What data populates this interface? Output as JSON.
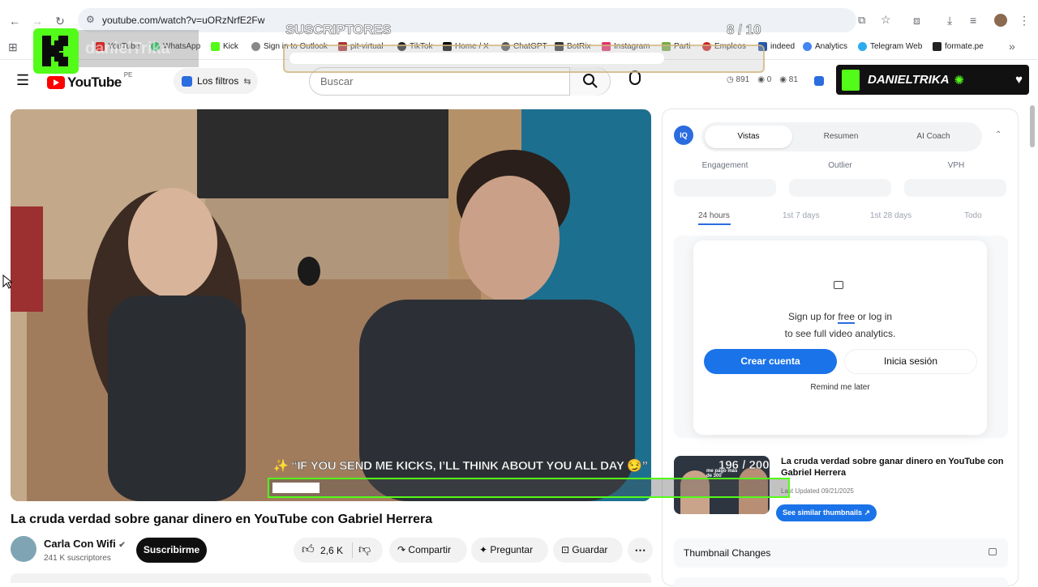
{
  "browser": {
    "url": "youtube.com/watch?v=uORzNrfE2Fw",
    "bookmarks": [
      "YouTube",
      "WhatsApp",
      "Kick",
      "Sign in to Outlook",
      "pit-virtual",
      "TikTok",
      "Home / X",
      "ChatGPT",
      "BotRix",
      "Instagram",
      "Parti",
      "Empleos",
      "indeed",
      "Analytics",
      "Telegram Web",
      "formate.pe"
    ]
  },
  "youtube": {
    "logo": "YouTube",
    "country": "PE",
    "filters_label": "Los filtros",
    "search_placeholder": "Buscar",
    "stats": {
      "views": "891",
      "a": "0",
      "b": "81"
    }
  },
  "video": {
    "title": "La cruda verdad sobre ganar dinero en YouTube con Gabriel Herrera",
    "channel": "Carla Con Wifi",
    "subscribers": "241 K suscriptores",
    "subscribe_label": "Suscribirme",
    "likes": "2,6 K",
    "share_label": "Compartir",
    "ask_label": "Preguntar",
    "save_label": "Guardar"
  },
  "panel": {
    "tabs": [
      "Vistas",
      "Resumen",
      "AI Coach"
    ],
    "metrics": [
      "Engagement",
      "Outlier",
      "VPH"
    ],
    "ranges": [
      "24 hours",
      "1st 7 days",
      "1st 28 days",
      "Todo"
    ],
    "signup_line1_a": "Sign up for ",
    "signup_free": "free",
    "signup_line1_b": " or log in",
    "signup_line2": "to see full video analytics.",
    "create_account": "Crear cuenta",
    "login": "Inicia sesión",
    "remind": "Remind me later",
    "thumb_title": "La cruda verdad sobre ganar dinero en YouTube con Gabriel Herrera",
    "last_updated": "Last Updated 09/21/2025",
    "similar": "See similar thumbnails",
    "thumb_changes": "Thumbnail Changes",
    "thumb_text": "me pago más de 300"
  },
  "overlay": {
    "kick_name": "DANIELTRIKA",
    "ghost_name": "danielTrika",
    "subs_label": "SUSCRIPTORES",
    "subs_progress": "8 / 10",
    "subs_fraction": 0.8,
    "kicks_msg": "✨ “IF YOU SEND ME KICKS, I’LL THINK ABOUT YOU ALL DAY 😏”",
    "kicks_progress": "196 / 200",
    "kicks_fraction": 0.98
  },
  "colors": {
    "kick": "#53fc18",
    "yt_red": "#ff0000",
    "blue": "#1a73e8"
  }
}
